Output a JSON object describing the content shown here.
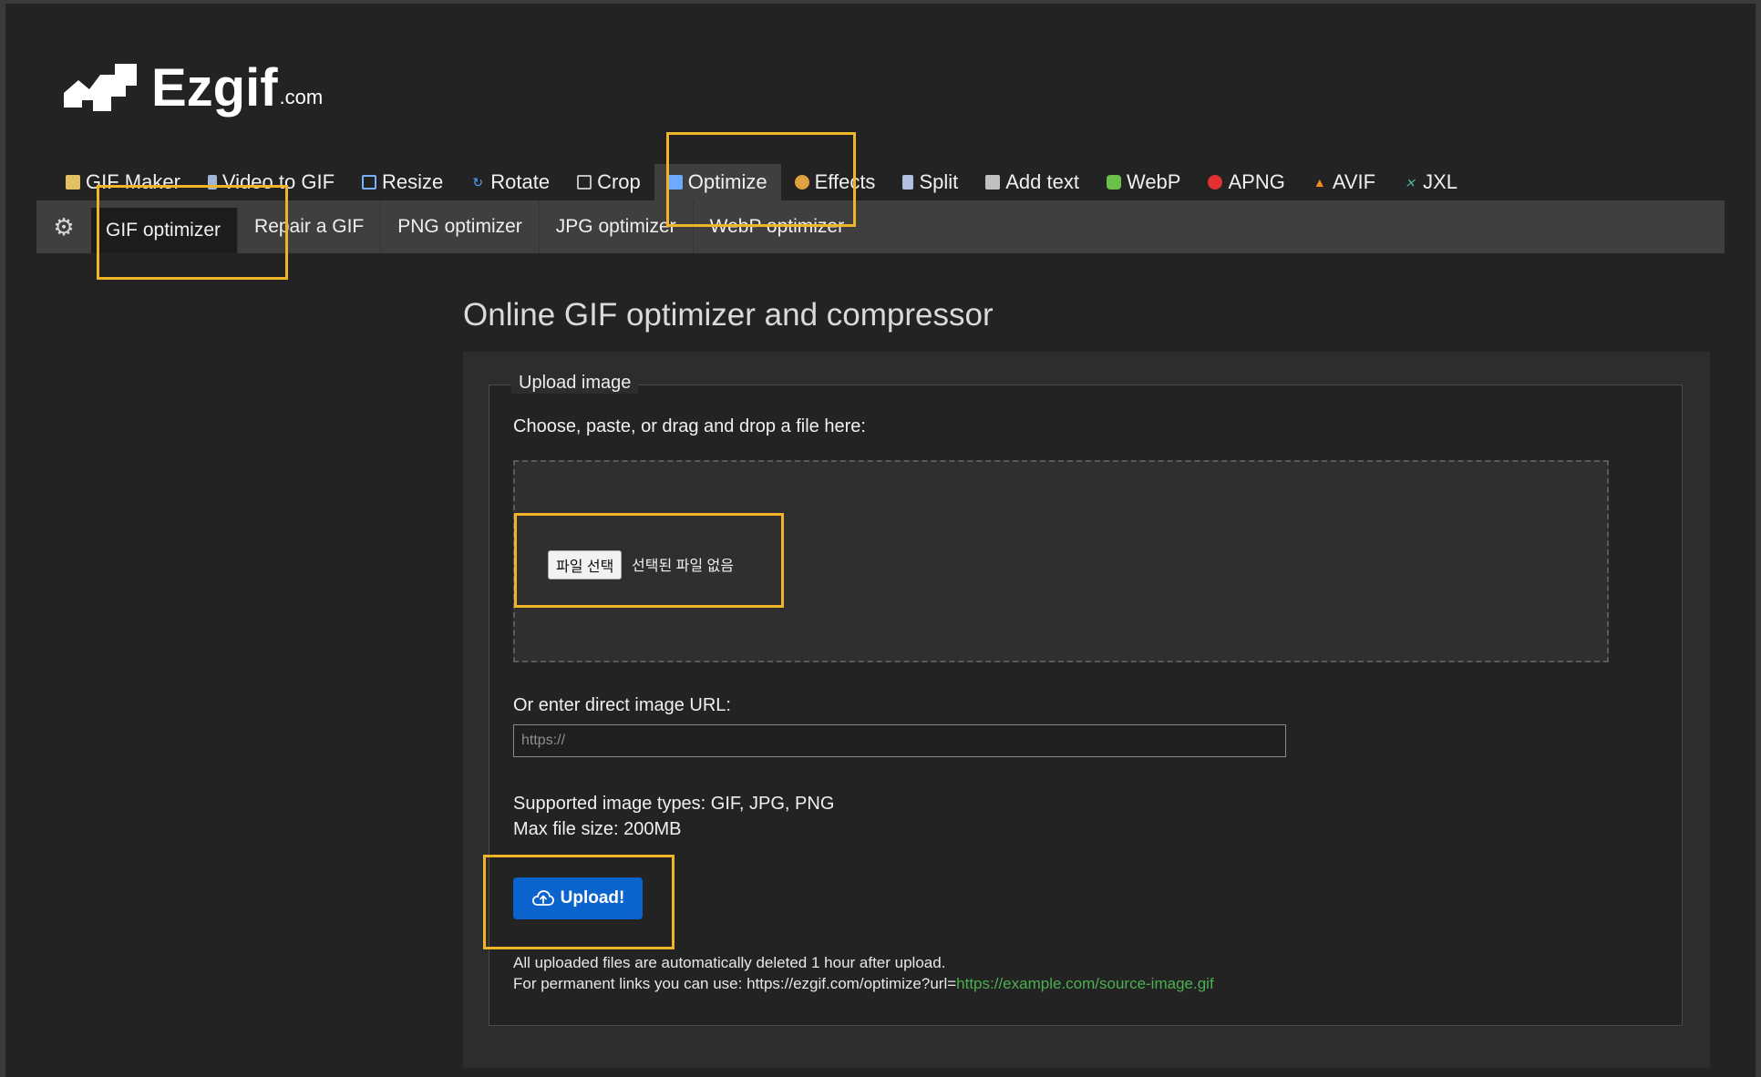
{
  "logo": {
    "text": "Ezgif",
    "suffix": ".com"
  },
  "main_nav": [
    {
      "label": "GIF Maker",
      "icon": "gif-maker-icon",
      "color": "#e0c060"
    },
    {
      "label": "Video to GIF",
      "icon": "film-icon",
      "color": "#9fb6d8"
    },
    {
      "label": "Resize",
      "icon": "resize-icon",
      "color": "#7ab0ff"
    },
    {
      "label": "Rotate",
      "icon": "rotate-icon",
      "color": "#5aa0ff"
    },
    {
      "label": "Crop",
      "icon": "crop-icon",
      "color": "#c0c0c0"
    },
    {
      "label": "Optimize",
      "icon": "optimize-icon",
      "color": "#6fa8ff"
    },
    {
      "label": "Effects",
      "icon": "palette-icon",
      "color": "#e0a040"
    },
    {
      "label": "Split",
      "icon": "split-icon",
      "color": "#b0c0e0"
    },
    {
      "label": "Add text",
      "icon": "add-text-icon",
      "color": "#c0c0c0"
    },
    {
      "label": "WebP",
      "icon": "webp-icon",
      "color": "#6cc04a"
    },
    {
      "label": "APNG",
      "icon": "apng-icon",
      "color": "#e03030"
    },
    {
      "label": "AVIF",
      "icon": "avif-icon",
      "color": "#f08c20"
    },
    {
      "label": "JXL",
      "icon": "jxl-icon",
      "color": "#4dc0b0"
    }
  ],
  "sub_nav": [
    {
      "label": "GIF optimizer"
    },
    {
      "label": "Repair a GIF"
    },
    {
      "label": "PNG optimizer"
    },
    {
      "label": "JPG optimizer"
    },
    {
      "label": "WebP optimizer"
    }
  ],
  "page": {
    "title": "Online GIF optimizer and compressor",
    "legend": "Upload image",
    "choose_label": "Choose, paste, or drag and drop a file here:",
    "file_button": "파일 선택",
    "file_status": "선택된 파일 없음",
    "url_label": "Or enter direct image URL:",
    "url_placeholder": "https://",
    "supported_types": "Supported image types: GIF, JPG, PNG",
    "max_size": "Max file size: 200MB",
    "upload_button": "Upload!",
    "note_line1": "All uploaded files are automatically deleted 1 hour after upload.",
    "note_line2_prefix": "For permanent links you can use: https://ezgif.com/optimize?url=",
    "note_line2_link": "https://example.com/source-image.gif"
  },
  "colors": {
    "accent_blue": "#0b63ce",
    "highlight": "#f0b429",
    "link_green": "#4caf50"
  }
}
